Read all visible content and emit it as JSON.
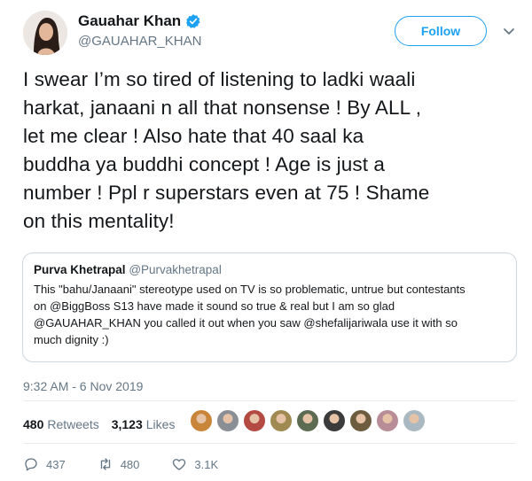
{
  "author": {
    "name": "Gauahar Khan",
    "handle": "@GAUAHAR_KHAN"
  },
  "follow_label": "Follow",
  "tweet_lines": [
    "I swear I’m so tired of listening to ladki waali",
    "harkat, janaani n all that nonsense ! By ALL ,",
    "let me clear ! Also hate that 40 saal ka",
    "buddha ya buddhi concept ! Age is just a",
    "number ! Ppl r superstars even at 75 ! Shame",
    "on this mentality!"
  ],
  "quote": {
    "name": "Purva Khetrapal",
    "handle": "@Purvakhetrapal",
    "lines": [
      "This \"bahu/Janaani\" stereotype used on TV is so problematic, untrue but contestants",
      "on @BiggBoss S13 have made it sound so true & real but I am so glad",
      "@GAUAHAR_KHAN you called it out when you saw @shefalijariwala use it with so",
      "much dignity :)"
    ]
  },
  "timestamp": "9:32 AM - 6 Nov 2019",
  "stats": {
    "retweets_count": "480",
    "retweets_label": "Retweets",
    "likes_count": "3,123",
    "likes_label": "Likes"
  },
  "liker_avatar_colors": [
    "#c9863a",
    "#8a8f96",
    "#b44b43",
    "#a08a52",
    "#5d6b52",
    "#3b3b3b",
    "#6e5c3f",
    "#b98d97",
    "#aab8c2"
  ],
  "actions": {
    "replies": "437",
    "retweets": "480",
    "likes": "3.1K"
  },
  "icons": [
    "verified-badge-icon",
    "chevron-down-icon",
    "reply-icon",
    "retweet-icon",
    "like-icon"
  ],
  "colors": {
    "brand": "#1da1f2",
    "muted": "#657786",
    "text": "#14171a",
    "border": "#ccd6dd"
  }
}
